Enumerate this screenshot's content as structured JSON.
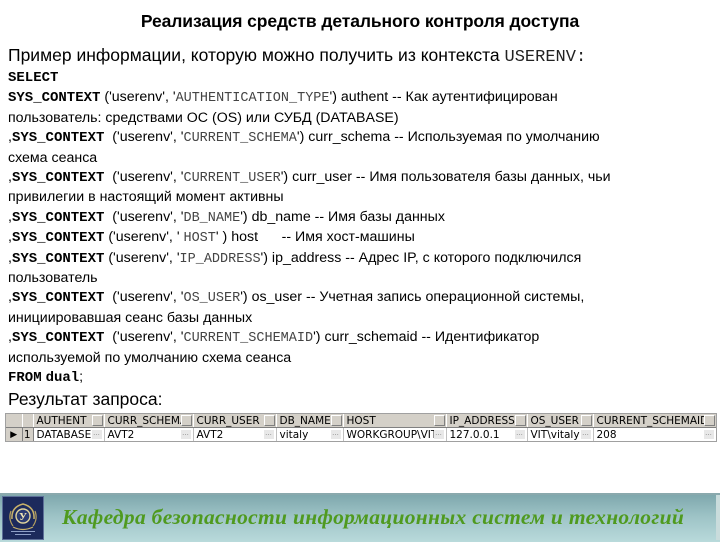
{
  "slide": {
    "title": "Реализация средств детального контроля доступа",
    "intro_text": "Пример информации, которую можно получить из контекста ",
    "intro_context": "USERENV",
    "intro_colon": ":"
  },
  "code": {
    "select_kw": "SELECT",
    "func": "SYS_CONTEXT",
    "entries": [
      {
        "prefix": "",
        "open": " ('userenv', '",
        "param": "AUTHENTICATION_TYPE",
        "close": "') ",
        "alias": "authent -- Как аутентифицирован",
        "continuation": "пользователь: средствами ОС (OS) или СУБД (DATABASE)"
      },
      {
        "prefix": ",",
        "open": "  ('userenv', '",
        "param": "CURRENT_SCHEMA",
        "close": "') ",
        "alias": "curr_schema -- Используемая по умолчанию",
        "continuation": "схема сеанса"
      },
      {
        "prefix": ",",
        "open": "  ('userenv', '",
        "param": "CURRENT_USER",
        "close": "') ",
        "alias": "curr_user -- Имя пользователя базы данных, чьи",
        "continuation": "привилегии в настоящий момент активны"
      },
      {
        "prefix": ",",
        "open": "  ('userenv', '",
        "param": "DB_NAME",
        "close": "') ",
        "alias": "db_name -- Имя базы данных",
        "continuation": ""
      },
      {
        "prefix": ",",
        "open": " ('userenv', ' ",
        "param": "HOST",
        "close": "' ) ",
        "alias": "host      -- Имя хост-машины",
        "continuation": ""
      },
      {
        "prefix": ",",
        "open": " ('userenv', '",
        "param": "IP_ADDRESS",
        "close": "') ",
        "alias": "ip_address -- Адрес IP, с которого подключился",
        "continuation": "пользователь"
      },
      {
        "prefix": ",",
        "open": "  ('userenv', '",
        "param": "OS_USER",
        "close": "') ",
        "alias": "os_user -- Учетная запись операционной системы,",
        "continuation": "инициировавшая сеанс базы данных"
      },
      {
        "prefix": ",",
        "open": "  ('userenv', '",
        "param": "CURRENT_SCHEMAID",
        "close": "') ",
        "alias": "curr_schemaid -- Идентификатор",
        "continuation": "используемой по умолчанию схема сеанса"
      }
    ],
    "from_kw": "FROM",
    "from_table": "dual",
    "terminator": ";"
  },
  "result": {
    "label": "Результат запроса:",
    "columns": [
      "AUTHENT",
      "CURR_SCHEMA",
      "CURR_USER",
      "DB_NAME",
      "HOST",
      "IP_ADDRESS",
      "OS_USER",
      "CURRENT_SCHEMAID"
    ],
    "rows": [
      {
        "row_number": "1",
        "indicator": "▶",
        "cells": [
          "DATABASE",
          "AVT2",
          "AVT2",
          "vitaly",
          "WORKGROUP\\VIT",
          "127.0.0.1",
          "VIT\\vitaly",
          "208"
        ]
      }
    ],
    "ellipsis": "..."
  },
  "footer": {
    "text": "Кафедра безопасности информационных систем и технологий",
    "logo_letter": "У"
  }
}
